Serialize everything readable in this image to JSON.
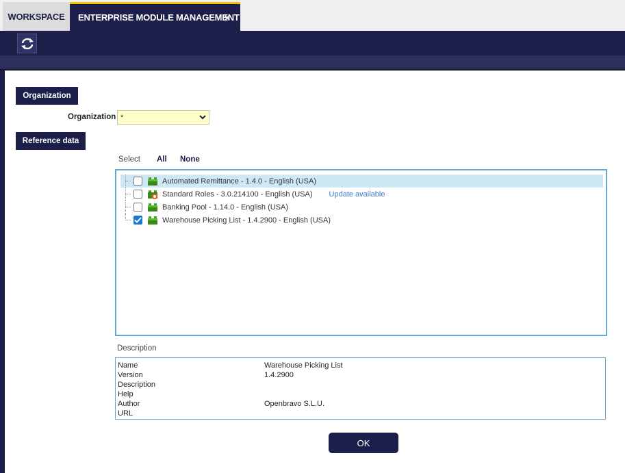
{
  "tabs": {
    "workspace": "WORKSPACE",
    "active": "ENTERPRISE MODULE MANAGEMENT",
    "close": "×"
  },
  "toolbar": {
    "refresh_icon": "refresh-icon"
  },
  "organization_section": {
    "button_label": "Organization",
    "field_label": "Organization",
    "field_value": "*"
  },
  "reference_section": {
    "button_label": "Reference data",
    "select_label": "Select",
    "select_all": "All",
    "select_none": "None",
    "modules": [
      {
        "label": "Automated Remittance - 1.4.0 - English (USA)",
        "checked": false,
        "selected": true,
        "icon": "module-icon",
        "update": ""
      },
      {
        "label": "Standard Roles - 3.0.214100 - English (USA)",
        "checked": false,
        "selected": false,
        "icon": "module-update-icon",
        "update": "Update available"
      },
      {
        "label": "Banking Pool - 1.14.0 - English (USA)",
        "checked": false,
        "selected": false,
        "icon": "module-icon",
        "update": ""
      },
      {
        "label": "Warehouse Picking List - 1.4.2900 - English (USA)",
        "checked": true,
        "selected": false,
        "icon": "module-icon",
        "update": ""
      }
    ]
  },
  "description": {
    "title": "Description",
    "fields": [
      {
        "name": "Name",
        "value": "Warehouse Picking List"
      },
      {
        "name": "Version",
        "value": "1.4.2900"
      },
      {
        "name": "Description",
        "value": ""
      },
      {
        "name": "Help",
        "value": ""
      },
      {
        "name": "Author",
        "value": "Openbravo S.L.U."
      },
      {
        "name": "URL",
        "value": ""
      }
    ]
  },
  "ok_button": "OK",
  "colors": {
    "navy": "#1c1f4a",
    "accent": "#f5c400",
    "link": "#3a7bc8",
    "selection": "#cfe8f6"
  }
}
